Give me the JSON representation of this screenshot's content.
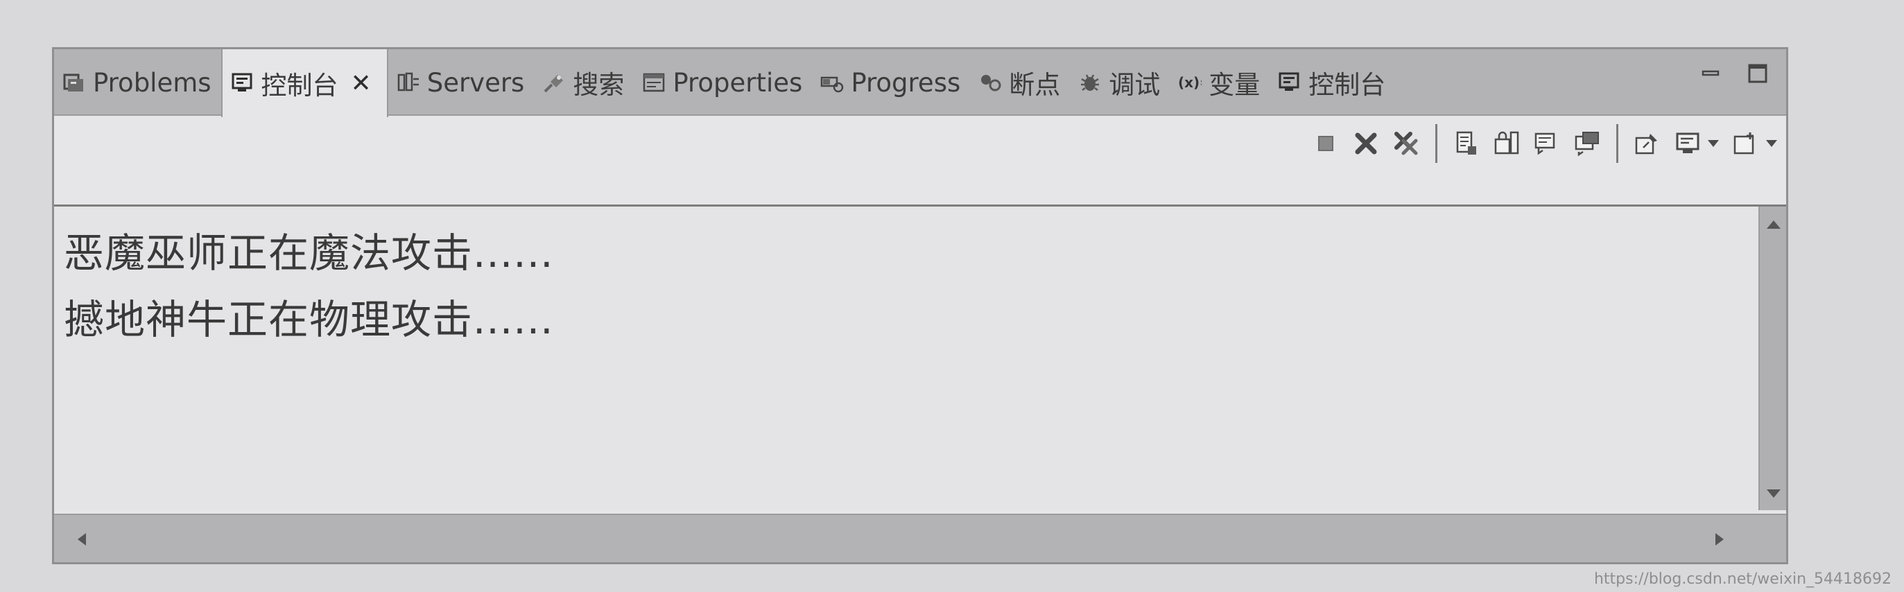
{
  "tabs": [
    {
      "label": "Problems",
      "icon": "problems-icon",
      "active": false
    },
    {
      "label": "控制台",
      "icon": "console-icon",
      "active": true,
      "closable": true
    },
    {
      "label": "Servers",
      "icon": "servers-icon",
      "active": false
    },
    {
      "label": "搜索",
      "icon": "search-icon",
      "active": false
    },
    {
      "label": "Properties",
      "icon": "properties-icon",
      "active": false
    },
    {
      "label": "Progress",
      "icon": "progress-icon",
      "active": false
    },
    {
      "label": "断点",
      "icon": "breakpoints-icon",
      "active": false
    },
    {
      "label": "调试",
      "icon": "debug-icon",
      "active": false
    },
    {
      "label": "变量",
      "icon": "variables-icon",
      "active": false
    },
    {
      "label": "控制台",
      "icon": "console-icon",
      "active": false
    }
  ],
  "tab_close_glyph": "✕",
  "window_controls": [
    "minimize-icon",
    "maximize-icon"
  ],
  "toolbar": [
    "terminate-icon",
    "remove-launch-icon",
    "remove-all-terminated-icon",
    "clear-console-icon",
    "scroll-lock-icon",
    "word-wrap-icon",
    "show-console-on-output-icon",
    "pin-console-icon",
    "display-selected-console-icon",
    "open-console-icon"
  ],
  "console": {
    "lines": [
      "恶魔巫师正在魔法攻击......",
      "撼地神牛正在物理攻击......"
    ]
  },
  "watermark": "https://blog.csdn.net/weixin_54418692"
}
